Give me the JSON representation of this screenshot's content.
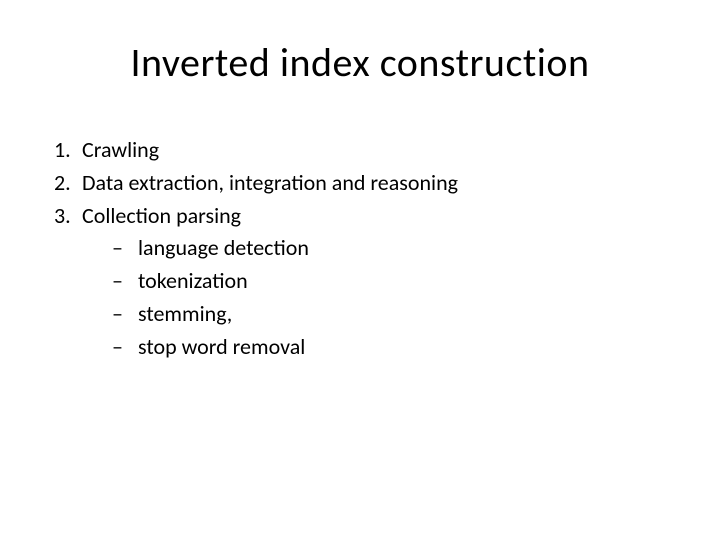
{
  "title": "Inverted index construction",
  "list": [
    {
      "num": "1.",
      "text": "Crawling"
    },
    {
      "num": "2.",
      "text": "Data extraction, integration and reasoning"
    },
    {
      "num": "3.",
      "text": "Collection parsing"
    }
  ],
  "sublist": [
    {
      "dash": "–",
      "text": "language detection"
    },
    {
      "dash": "–",
      "text": "tokenization"
    },
    {
      "dash": "–",
      "text": "stemming,"
    },
    {
      "dash": "–",
      "text": "stop word removal"
    }
  ]
}
